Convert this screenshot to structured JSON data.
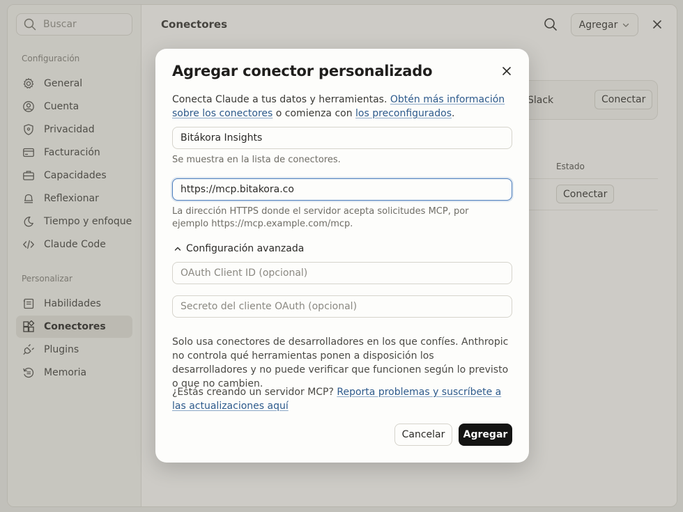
{
  "sidebar": {
    "search_placeholder": "Buscar",
    "section_config": "Configuración",
    "section_personalize": "Personalizar",
    "items_config": [
      {
        "label": "General",
        "icon": "gear-icon"
      },
      {
        "label": "Cuenta",
        "icon": "user-icon"
      },
      {
        "label": "Privacidad",
        "icon": "shield-icon"
      },
      {
        "label": "Facturación",
        "icon": "card-icon"
      },
      {
        "label": "Capacidades",
        "icon": "briefcase-icon"
      },
      {
        "label": "Reflexionar",
        "icon": "bell-icon"
      },
      {
        "label": "Tiempo y enfoque",
        "icon": "moon-icon"
      },
      {
        "label": "Claude Code",
        "icon": "code-icon"
      }
    ],
    "items_personalize": [
      {
        "label": "Habilidades",
        "icon": "skills-icon"
      },
      {
        "label": "Conectores",
        "icon": "connectors-icon",
        "active": true
      },
      {
        "label": "Plugins",
        "icon": "plug-icon"
      },
      {
        "label": "Memoria",
        "icon": "memory-icon"
      }
    ]
  },
  "main": {
    "title": "Conectores",
    "add_label": "Agregar",
    "slack_label": "Slack",
    "connect_label": "Conectar",
    "status_header": "Estado",
    "row_connect_label": "Conectar"
  },
  "modal": {
    "title": "Agregar conector personalizado",
    "intro_text": "Conecta Claude a tus datos y herramientas.",
    "intro_link1": "Obtén más información sobre los conectores",
    "intro_mid": "o comienza con",
    "intro_link2": "los preconfigurados",
    "intro_end": ".",
    "name_value": "Bitákora Insights",
    "name_hint": "Se muestra en la lista de conectores.",
    "url_value": "https://mcp.bitakora.co",
    "url_hint": "La dirección HTTPS donde el servidor acepta solicitudes MCP, por ejemplo https://mcp.example.com/mcp.",
    "advanced_label": "Configuración avanzada",
    "client_id_placeholder": "OAuth Client ID (opcional)",
    "client_secret_placeholder": "Secreto del cliente OAuth (opcional)",
    "warning": "Solo usa conectores de desarrolladores en los que confíes. Anthropic no controla qué herramientas ponen a disposición los desarrolladores y no puede verificar que funcionen según lo previsto o que no cambien.",
    "mcp_text": "¿Estás creando un servidor MCP?",
    "mcp_link": "Reporta problemas y suscríbete a las actualizaciones aquí",
    "cancel_label": "Cancelar",
    "add_label": "Agregar"
  }
}
